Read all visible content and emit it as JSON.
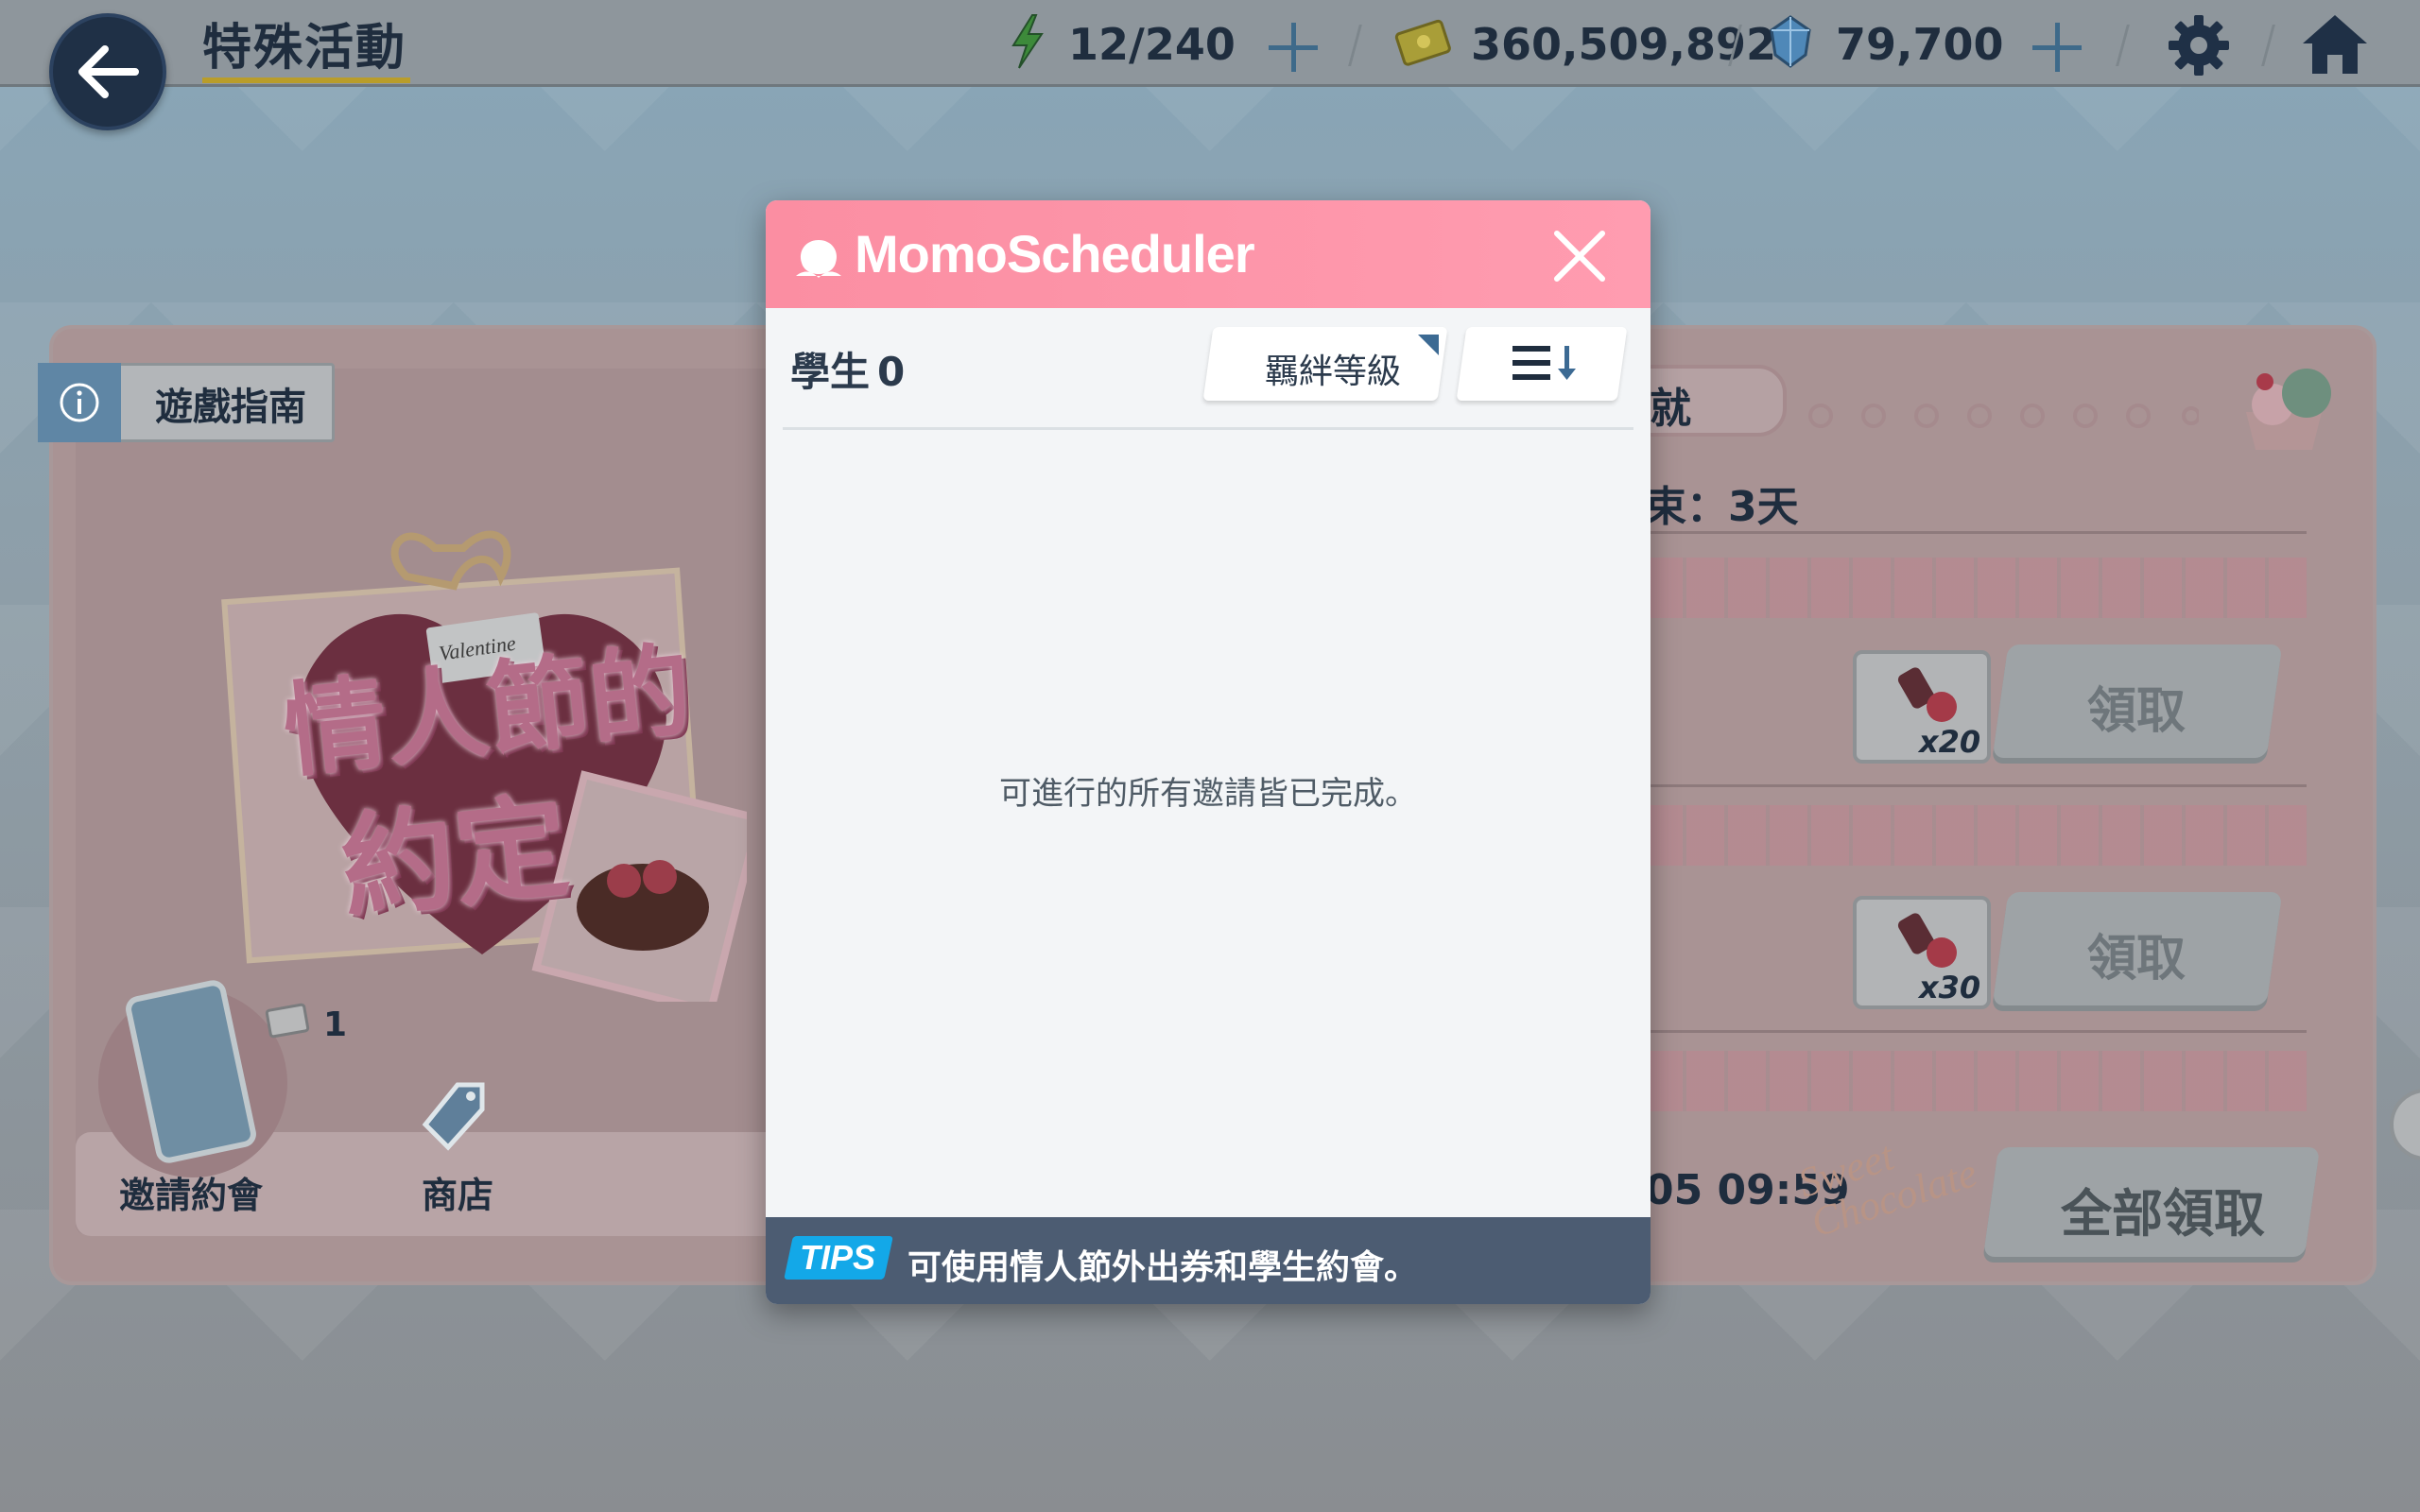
{
  "top_bar": {
    "title": "特殊活動",
    "stamina": "12/240",
    "credits": "360,509,892",
    "pyroxene": "79,700"
  },
  "event": {
    "guide_label": "遊戲指南",
    "logo_line1": "情人節的",
    "logo_line2": "約定",
    "logo_badge": "Valentine",
    "menu": {
      "invite_label": "邀請約會",
      "shop_label": "商店",
      "ticket_count": "1"
    },
    "side": {
      "achievement_tab_partial": "就",
      "end_text_partial": "束：3天",
      "rewards": [
        {
          "qty": "x20",
          "claim_label": "領取"
        },
        {
          "qty": "x30",
          "claim_label": "領取"
        }
      ],
      "time_partial": "05 09:59",
      "sweet_text": "Sweet Chocolate",
      "claim_all_label": "全部領取"
    }
  },
  "modal": {
    "title": "MomoScheduler",
    "student_label": "學生",
    "student_count": "0",
    "sort_label": "羈絆等級",
    "empty_message": "可進行的所有邀請皆已完成。",
    "tips_badge": "TIPS",
    "tips_text": "可使用情人節外出券和學生約會。"
  },
  "colors": {
    "modal_header": "#ff98ac",
    "tips_bar": "#4c5c72",
    "tips_badge": "#13a8e8",
    "nav_dark": "#1f3046"
  }
}
